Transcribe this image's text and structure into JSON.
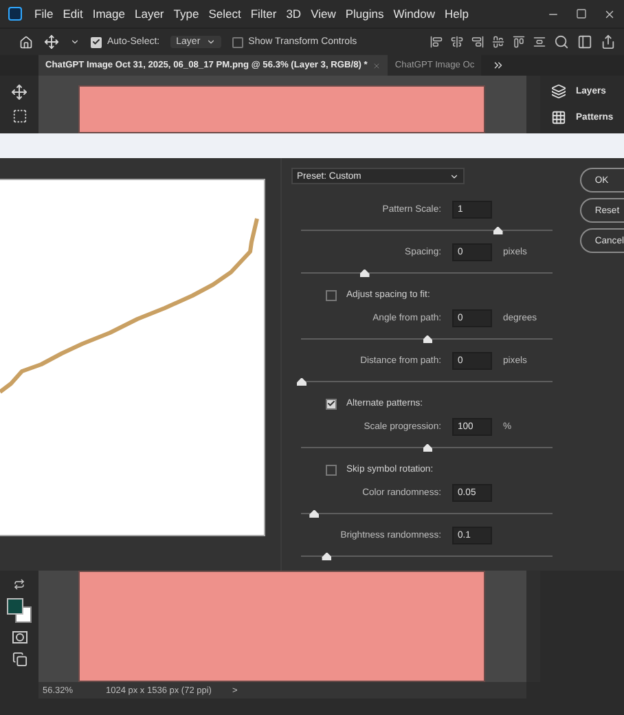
{
  "menu_bar": {
    "items": [
      "File",
      "Edit",
      "Image",
      "Layer",
      "Type",
      "Select",
      "Filter",
      "3D",
      "View",
      "Plugins",
      "Window",
      "Help"
    ]
  },
  "options_bar": {
    "auto_select": {
      "label": "Auto-Select:",
      "checked": true
    },
    "target_dropdown": {
      "value": "Layer"
    },
    "transform_controls": {
      "label": "Show Transform Controls",
      "checked": false
    }
  },
  "document_tabs": [
    {
      "title": "ChatGPT Image Oct 31, 2025, 06_08_17 PM.png @ 56.3% (Layer 3, RGB/8) *",
      "selected": true
    },
    {
      "title": "ChatGPT Image Oc",
      "selected": false
    }
  ],
  "right_panel": {
    "items": [
      {
        "label": "Layers",
        "kind": "layers"
      },
      {
        "label": "Patterns",
        "kind": "patterns"
      }
    ]
  },
  "dialog": {
    "preset": "Preset: Custom",
    "buttons": [
      "OK",
      "Reset",
      "Cancel"
    ],
    "controls": [
      {
        "kind": "field",
        "label": "Pattern Scale:",
        "value": "1",
        "level": 0.78
      },
      {
        "kind": "field",
        "label": "Spacing:",
        "value": "0",
        "unit": "pixels",
        "level": 0.25
      },
      {
        "kind": "checkbox",
        "label": "Adjust spacing to fit:",
        "checked": false
      },
      {
        "kind": "field",
        "label": "Angle from path:",
        "value": "0",
        "unit": "degrees",
        "level": 0.5
      },
      {
        "kind": "field",
        "label": "Distance from path:",
        "value": "0",
        "unit": "pixels",
        "level": 0.0
      },
      {
        "kind": "checkbox",
        "label": "Alternate patterns:",
        "checked": true
      },
      {
        "kind": "field",
        "label": "Scale progression:",
        "value": "100",
        "unit": "%",
        "level": 0.5
      },
      {
        "kind": "checkbox",
        "label": "Skip symbol rotation:",
        "checked": false
      },
      {
        "kind": "field",
        "label": "Color randomness:",
        "value": "0.05",
        "level": 0.05
      },
      {
        "kind": "field",
        "label": "Brightness randomness:",
        "value": "0.1",
        "level": 0.1
      }
    ]
  },
  "status_bar": {
    "zoom": "56.32%",
    "document_info": "1024 px x 1536 px (72 ppi)",
    "expand": ">"
  }
}
